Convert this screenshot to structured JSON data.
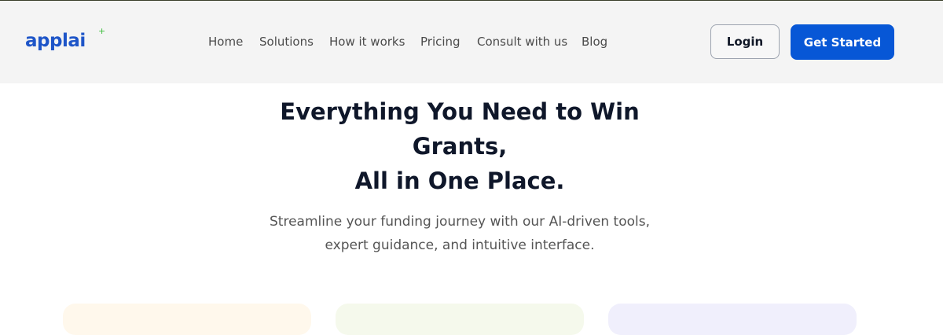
{
  "brand": {
    "logo_text": "applai",
    "logo_spark": "+"
  },
  "nav": {
    "items": [
      {
        "label": "Home"
      },
      {
        "label": "Solutions"
      },
      {
        "label": "How it works"
      },
      {
        "label": "Pricing"
      },
      {
        "label": "Consult with us"
      },
      {
        "label": "Blog"
      }
    ]
  },
  "header_actions": {
    "login_label": "Login",
    "get_started_label": "Get Started"
  },
  "hero": {
    "title_lines": [
      "Everything You Need to Win",
      "Grants,",
      "All in One Place."
    ],
    "subtitle_lines": [
      "Streamline your funding journey with our AI-driven tools,",
      "expert guidance, and intuitive interface."
    ]
  },
  "colors": {
    "brand_blue": "#1e55c8",
    "primary_button": "#0757d6",
    "header_bg": "#f4f4f4",
    "card_tints": [
      "#fff8ec",
      "#f5f9ec",
      "#f0effc"
    ]
  }
}
